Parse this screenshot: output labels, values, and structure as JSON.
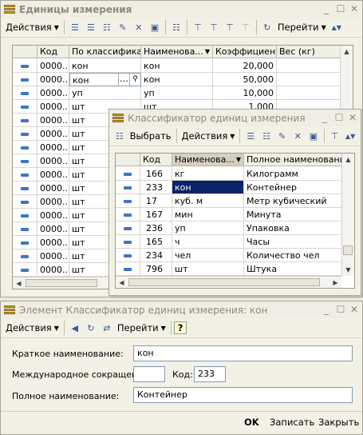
{
  "win1": {
    "title": "Единицы измерения",
    "toolbar": {
      "actions": "Действия",
      "goto": "Перейти"
    },
    "columns": [
      "Код",
      "По классифика...",
      "Наименова...",
      "Коэффициент",
      "Вес (кг)"
    ],
    "rows": [
      {
        "code": "0000...",
        "classifier": "кон",
        "name": "кон",
        "coef": "20,000",
        "weight": ""
      },
      {
        "code": "0000...",
        "classifier": "кон",
        "name": "кон",
        "coef": "50,000",
        "weight": ""
      },
      {
        "code": "0000...",
        "classifier": "уп",
        "name": "уп",
        "coef": "10,000",
        "weight": ""
      },
      {
        "code": "0000...",
        "classifier": "шт",
        "name": "шт",
        "coef": "1,000",
        "weight": ""
      },
      {
        "code": "0000...",
        "classifier": "шт"
      },
      {
        "code": "0000...",
        "classifier": "шт"
      },
      {
        "code": "0000...",
        "classifier": "шт"
      },
      {
        "code": "0000...",
        "classifier": "шт"
      },
      {
        "code": "0000...",
        "classifier": "шт"
      },
      {
        "code": "0000...",
        "classifier": "шт"
      },
      {
        "code": "0000...",
        "classifier": "шт"
      },
      {
        "code": "0000...",
        "classifier": "шт"
      },
      {
        "code": "0000...",
        "classifier": "шт"
      },
      {
        "code": "0000...",
        "classifier": "шт"
      },
      {
        "code": "0000...",
        "classifier": "шт"
      },
      {
        "code": "0000...",
        "classifier": "шт"
      }
    ]
  },
  "win2": {
    "title": "Классификатор единиц измерения",
    "toolbar": {
      "select": "Выбрать",
      "actions": "Действия"
    },
    "columns": [
      "Код",
      "Наименова...",
      "Полное наименование"
    ],
    "rows": [
      {
        "code": "166",
        "name": "кг",
        "full": "Килограмм"
      },
      {
        "code": "233",
        "name": "кон",
        "full": "Контейнер"
      },
      {
        "code": "17",
        "name": "куб. м",
        "full": "Метр кубический"
      },
      {
        "code": "167",
        "name": "мин",
        "full": "Минута"
      },
      {
        "code": "236",
        "name": "уп",
        "full": "Упаковка"
      },
      {
        "code": "165",
        "name": "ч",
        "full": "Часы"
      },
      {
        "code": "234",
        "name": "чел",
        "full": "Количество чел"
      },
      {
        "code": "796",
        "name": "шт",
        "full": "Штука"
      }
    ]
  },
  "win3": {
    "title": "Элемент Классификатор единиц измерения: кон",
    "toolbar": {
      "actions": "Действия",
      "goto": "Перейти",
      "help": "?"
    },
    "short_label": "Краткое наименование:",
    "short_value": "кон",
    "intl_label": "Международное сокращение:",
    "intl_value": "",
    "code_label": "Код:",
    "code_value": "233",
    "full_label": "Полное наименование:",
    "full_value": "Контейнер",
    "buttons": {
      "ok": "OK",
      "save": "Записать",
      "close": "Закрыть"
    }
  }
}
